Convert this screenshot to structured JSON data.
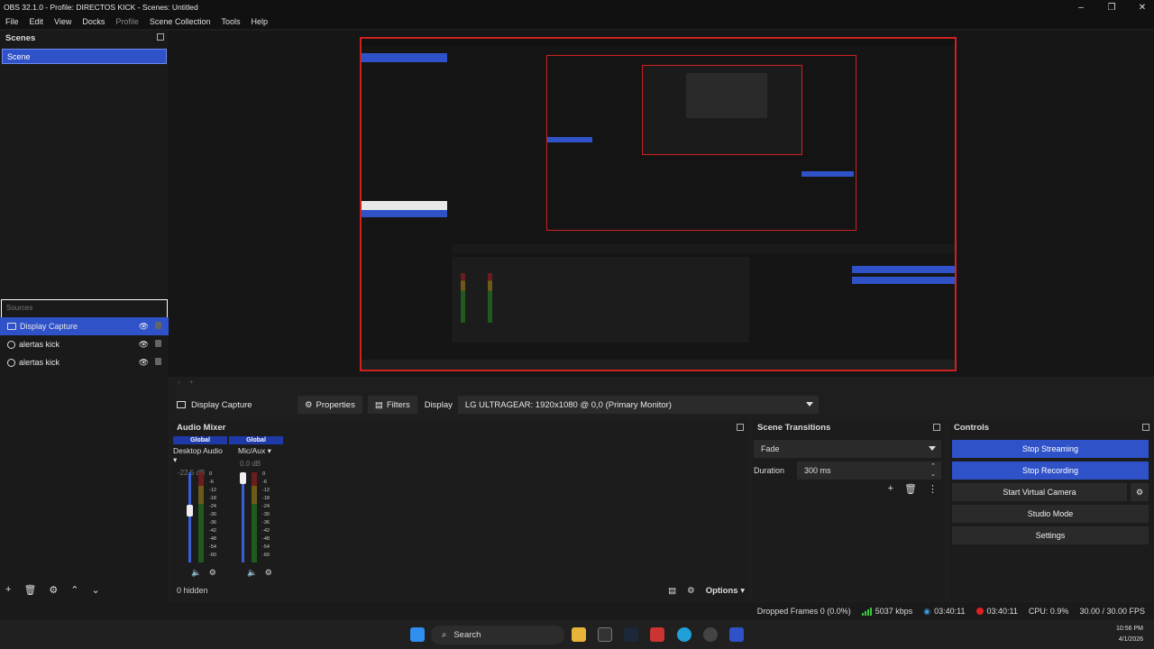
{
  "window": {
    "title": "OBS 32.1.0 - Profile: DIRECTOS KICK - Scenes: Untitled"
  },
  "menu": [
    "File",
    "Edit",
    "View",
    "Docks",
    "Profile",
    "Scene Collection",
    "Tools",
    "Help"
  ],
  "scenes": {
    "title": "Scenes",
    "items": [
      "Scene"
    ]
  },
  "sources": {
    "title": "Sources",
    "items": [
      {
        "label": "Display Capture",
        "icon": "monitor-icon"
      },
      {
        "label": "alertas kick",
        "icon": "globe-icon"
      },
      {
        "label": "alertas kick",
        "icon": "globe-icon"
      }
    ]
  },
  "context": {
    "source_name": "Display Capture",
    "properties": "Properties",
    "filters": "Filters",
    "display_label": "Display",
    "display_value": "LG ULTRAGEAR: 1920x1080 @ 0,0 (Primary Monitor)"
  },
  "mixer": {
    "title": "Audio Mixer",
    "channels": [
      {
        "badge": "Global",
        "name": "Desktop Audio",
        "db": "-22.5 dB",
        "level": 0.6
      },
      {
        "badge": "Global",
        "name": "Mic/Aux",
        "db": "0.0 dB",
        "level": 1.0
      }
    ],
    "scale": [
      "0",
      "-6",
      "-12",
      "-18",
      "-24",
      "-30",
      "-36",
      "-42",
      "-48",
      "-54",
      "-60"
    ],
    "hidden": "0 hidden",
    "options": "Options"
  },
  "transitions": {
    "title": "Scene Transitions",
    "type": "Fade",
    "duration_label": "Duration",
    "duration_value": "300 ms"
  },
  "controls": {
    "title": "Controls",
    "buttons": [
      "Stop Streaming",
      "Stop Recording",
      "Start Virtual Camera",
      "Studio Mode",
      "Settings"
    ]
  },
  "status": {
    "dropped": "Dropped Frames 0 (0.0%)",
    "bitrate": "5037 kbps",
    "stream_time": "03:40:11",
    "rec_time": "03:40:11",
    "cpu": "CPU: 0.9%",
    "fps": "30.00 / 30.00 FPS"
  },
  "taskbar": {
    "search": "Search",
    "time": "10:56 PM",
    "date": "4/1/2026"
  },
  "colors": {
    "accent": "#2f52c8",
    "preview_border": "#d02020",
    "recording": "#e02020",
    "stream": "#3aa0e0"
  }
}
